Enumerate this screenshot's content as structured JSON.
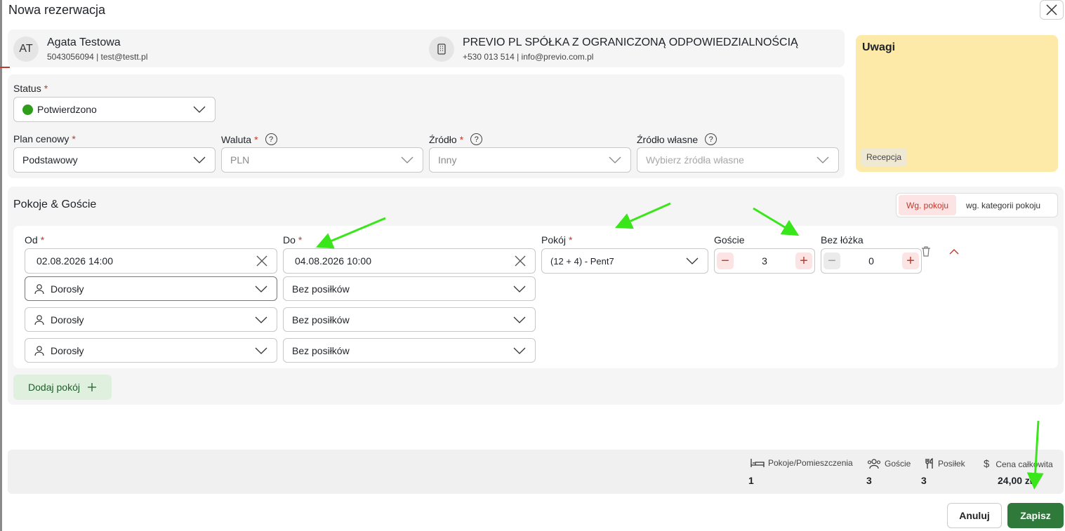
{
  "title": "Nowa rezerwacja",
  "guest": {
    "initials": "AT",
    "name": "Agata Testowa",
    "contact": "5043056094 | test@testt.pl"
  },
  "company": {
    "name": "PREVIO PL SPÓŁKA Z OGRANICZONĄ ODPOWIEDZIALNOŚCIĄ",
    "contact": "+530 013 514 | info@previo.com.pl"
  },
  "form": {
    "status_label": "Status",
    "status_value": "Potwierdzono",
    "plan_label": "Plan cenowy",
    "plan_value": "Podstawowy",
    "currency_label": "Waluta",
    "currency_value": "PLN",
    "source_label": "Źródło",
    "source_value": "Inny",
    "own_source_label": "Źródło własne",
    "own_source_placeholder": "Wybierz źródła własne",
    "required_mark": "*",
    "help_mark": "?"
  },
  "notes": {
    "title": "Uwagi",
    "tag": "Recepcja"
  },
  "rooms": {
    "section_title": "Pokoje & Goście",
    "toggle": [
      "Wg. pokoju",
      "wg. kategorii pokoju"
    ],
    "from_label": "Od",
    "from_value": "02.08.2026 14:00",
    "to_label": "Do",
    "to_value": "04.08.2026 10:00",
    "room_label": "Pokój",
    "room_value": "(12 + 4) - Pent7",
    "guests_label": "Goście",
    "guests_value": "3",
    "extra_bed_label": "Bez łóżka",
    "extra_bed_value": "0",
    "guest_rows": [
      {
        "type": "Dorosły",
        "meal": "Bez posiłków"
      },
      {
        "type": "Dorosły",
        "meal": "Bez posiłków"
      },
      {
        "type": "Dorosły",
        "meal": "Bez posiłków"
      }
    ],
    "add_room_label": "Dodaj pokój"
  },
  "summary": {
    "rooms_label": "Pokoje/Pomieszczenia",
    "rooms_value": "1",
    "guests_label": "Goście",
    "guests_value": "3",
    "meals_label": "Posiłek",
    "meals_value": "3",
    "price_label": "Cena całkowita",
    "price_value": "24,00 zł"
  },
  "actions": {
    "cancel": "Anuluj",
    "save": "Zapisz"
  },
  "colors": {
    "accent_green": "#2f7a3a",
    "status_green": "#2e9e1a",
    "notes_bg": "#fde9a8",
    "required_red": "#c0392b",
    "annotation_arrow": "#39e61a"
  }
}
